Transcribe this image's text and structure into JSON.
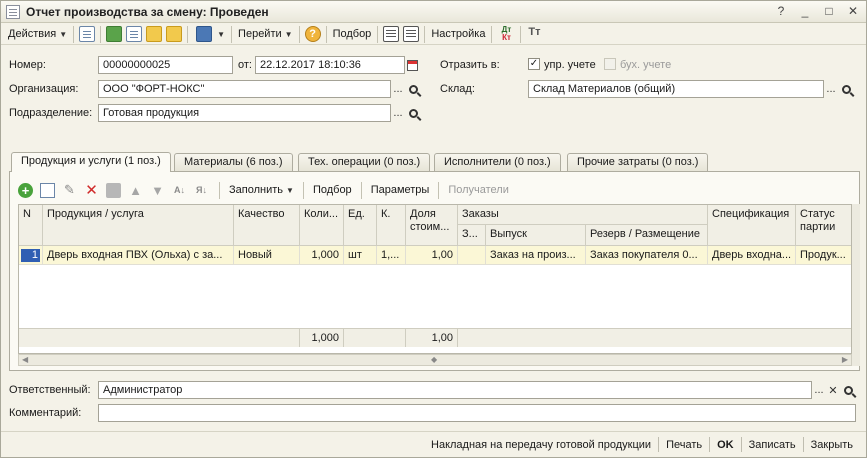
{
  "window": {
    "title": "Отчет производства за смену: Проведен"
  },
  "toolbar": {
    "actions_label": "Действия",
    "goto_label": "Перейти",
    "help_icon_text": "?",
    "selection_label": "Подбор",
    "settings_label": "Настройка",
    "dt_text": "Дт",
    "kt_text": "Кт"
  },
  "form": {
    "number_label": "Номер:",
    "number_value": "00000000025",
    "date_label": "от:",
    "date_value": "22.12.2017 18:10:36",
    "org_label": "Организация:",
    "org_value": "ООО \"ФОРТ-НОКС\"",
    "dept_label": "Подразделение:",
    "dept_value": "Готовая продукция",
    "reflect_label": "Отразить в:",
    "mgmt_label": "упр. учете",
    "mgmt_checked": true,
    "acct_label": "бух. учете",
    "acct_checked": false,
    "warehouse_label": "Склад:",
    "warehouse_value": "Склад Материалов (общий)",
    "responsible_label": "Ответственный:",
    "responsible_value": "Администратор",
    "comment_label": "Комментарий:",
    "comment_value": ""
  },
  "tabs": [
    {
      "label": "Продукция и услуги (1 поз.)",
      "active": true
    },
    {
      "label": "Материалы (6 поз.)",
      "active": false
    },
    {
      "label": "Тех. операции (0 поз.)",
      "active": false
    },
    {
      "label": "Исполнители (0 поз.)",
      "active": false
    },
    {
      "label": "Прочие затраты (0 поз.)",
      "active": false
    }
  ],
  "table_toolbar": {
    "fill_label": "Заполнить",
    "pick_label": "Подбор",
    "params_label": "Параметры",
    "recipients_label": "Получатели",
    "sort_asc_text": "А↓",
    "sort_desc_text": "Я↓"
  },
  "table": {
    "headers": {
      "n": "N",
      "product": "Продукция / услуга",
      "quality": "Качество",
      "qty": "Коли...",
      "unit": "Ед.",
      "k": "К.",
      "share": "Доля стоим...",
      "orders": "Заказы",
      "orders_z": "З...",
      "release": "Выпуск",
      "reserve": "Резерв / Размещение",
      "spec": "Спецификация",
      "batch_status": "Статус партии"
    },
    "rows": [
      {
        "n": "1",
        "product": "Дверь входная ПВХ (Ольха) с за...",
        "quality": "Новый",
        "qty": "1,000",
        "unit": "шт",
        "k": "1,...",
        "share": "1,00",
        "orders_z": "",
        "release": "Заказ на произ...",
        "reserve": "Заказ покупателя 0...",
        "spec": "Дверь входна...",
        "batch_status": "Продук..."
      }
    ],
    "totals": {
      "qty": "1,000",
      "share": "1,00"
    }
  },
  "statusbar": {
    "invoice_label": "Накладная на передачу готовой продукции",
    "print_label": "Печать",
    "ok_label": "OK",
    "save_label": "Записать",
    "close_label": "Закрыть"
  }
}
